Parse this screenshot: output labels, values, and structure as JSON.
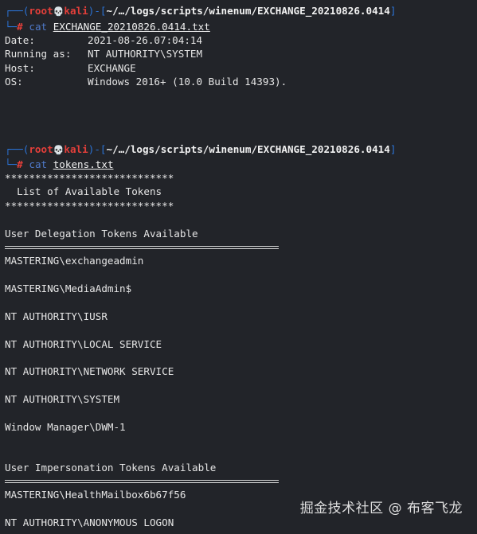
{
  "prompt": {
    "user": "root",
    "host": "kali",
    "skull": "💀",
    "path": "~/…/logs/scripts/winenum/EXCHANGE_20210826.0414",
    "symbol": "#"
  },
  "block1": {
    "command": "cat",
    "file": "EXCHANGE_20210826.0414.txt",
    "rows": [
      {
        "key": "Date:",
        "value": "2021-08-26.07:04:14"
      },
      {
        "key": "Running as:",
        "value": "NT AUTHORITY\\SYSTEM"
      },
      {
        "key": "Host:",
        "value": "EXCHANGE"
      },
      {
        "key": "OS:",
        "value": "Windows 2016+ (10.0 Build 14393)."
      }
    ]
  },
  "block2": {
    "command": "cat",
    "file": "tokens.txt",
    "stars": "****************************",
    "heading": "  List of Available Tokens",
    "delegation_heading": "User Delegation Tokens Available",
    "delegation_tokens": [
      "MASTERING\\exchangeadmin",
      "MASTERING\\MediaAdmin$",
      "NT AUTHORITY\\IUSR",
      "NT AUTHORITY\\LOCAL SERVICE",
      "NT AUTHORITY\\NETWORK SERVICE",
      "NT AUTHORITY\\SYSTEM",
      "Window Manager\\DWM-1"
    ],
    "impersonation_heading": "User Impersonation Tokens Available",
    "impersonation_tokens": [
      "MASTERING\\HealthMailbox6b67f56",
      "NT AUTHORITY\\ANONYMOUS LOGON"
    ]
  },
  "watermark": "掘金技术社区 @ 布客飞龙",
  "colors": {
    "background": "#222429",
    "prompt_box": "#2b73d6",
    "root_red": "#e43f3a",
    "command_blue": "#4f79c9",
    "text": "#e6e6e6"
  }
}
